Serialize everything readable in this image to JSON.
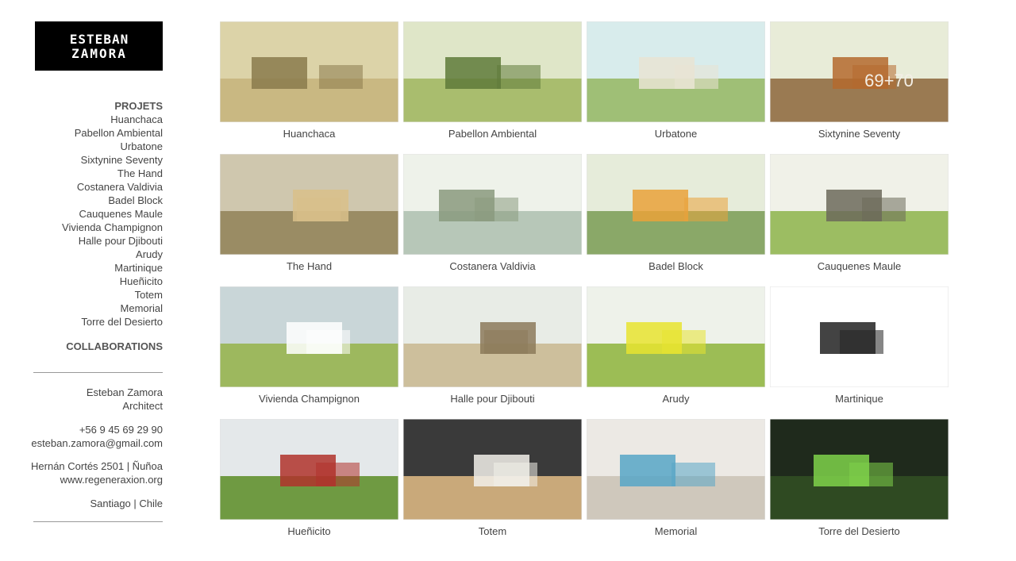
{
  "logo": {
    "line1": "ESTEBAN",
    "line2": "ZAMORA"
  },
  "nav": {
    "projects_heading": "PROJETS",
    "projects": [
      "Huanchaca",
      "Pabellon Ambiental",
      "Urbatone",
      "Sixtynine Seventy",
      "The Hand",
      "Costanera Valdivia",
      "Badel Block",
      "Cauquenes Maule",
      "Vivienda Champignon",
      "Halle pour Djibouti",
      "Arudy",
      "Martinique",
      "Hueñicito",
      "Totem",
      "Memorial",
      "Torre del Desierto"
    ],
    "collaborations_heading": "COLLABORATIONS"
  },
  "contact": {
    "name": "Esteban Zamora",
    "title": "Architect",
    "phone": "+56 9 45 69 29 90",
    "email": "esteban.zamora@gmail.com",
    "address": "Hernán Cortés 2501 | Ñuñoa",
    "website": "www.regeneraxion.org",
    "city": "Santiago | Chile"
  },
  "gallery": [
    {
      "caption": "Huanchaca",
      "sky": "#dcd3a8",
      "ground": "#c9b882",
      "accent": "#8a7a4c"
    },
    {
      "caption": "Pabellon Ambiental",
      "sky": "#dfe6c8",
      "ground": "#a9bd6e",
      "accent": "#5f7a3a"
    },
    {
      "caption": "Urbatone",
      "sky": "#d8ecec",
      "ground": "#9fbf76",
      "accent": "#e9e4d4"
    },
    {
      "caption": "Sixtynine Seventy",
      "sky": "#e8ecd8",
      "ground": "#9a7a52",
      "accent": "#b46a2e",
      "overlay_text": "69+70"
    },
    {
      "caption": "The Hand",
      "sky": "#cfc7ae",
      "ground": "#9a8c64",
      "accent": "#d9c08a"
    },
    {
      "caption": "Costanera Valdivia",
      "sky": "#eef2ea",
      "ground": "#b7c7b8",
      "accent": "#8a9a7e"
    },
    {
      "caption": "Badel Block",
      "sky": "#e6ecda",
      "ground": "#8aa868",
      "accent": "#e9a23a"
    },
    {
      "caption": "Cauquenes Maule",
      "sky": "#f0f1e8",
      "ground": "#9cbd62",
      "accent": "#6c6a5a"
    },
    {
      "caption": "Vivienda Champignon",
      "sky": "#c9d6d8",
      "ground": "#9db85e",
      "accent": "#ffffff"
    },
    {
      "caption": "Halle pour Djibouti",
      "sky": "#e8ece6",
      "ground": "#cdbf9c",
      "accent": "#8c7a5a"
    },
    {
      "caption": "Arudy",
      "sky": "#eef2ea",
      "ground": "#9cbd55",
      "accent": "#e8e430"
    },
    {
      "caption": "Martinique",
      "sky": "#ffffff",
      "ground": "#ffffff",
      "accent": "#222222"
    },
    {
      "caption": "Hueñicito",
      "sky": "#e4e8ea",
      "ground": "#6f9a42",
      "accent": "#b0322c"
    },
    {
      "caption": "Totem",
      "sky": "#3a3a3a",
      "ground": "#c9a97a",
      "accent": "#f2f0ea"
    },
    {
      "caption": "Memorial",
      "sky": "#ece9e4",
      "ground": "#cfc8bc",
      "accent": "#57a6c7"
    },
    {
      "caption": "Torre del Desierto",
      "sky": "#1f2a1c",
      "ground": "#2f4a22",
      "accent": "#7fd24a"
    }
  ]
}
